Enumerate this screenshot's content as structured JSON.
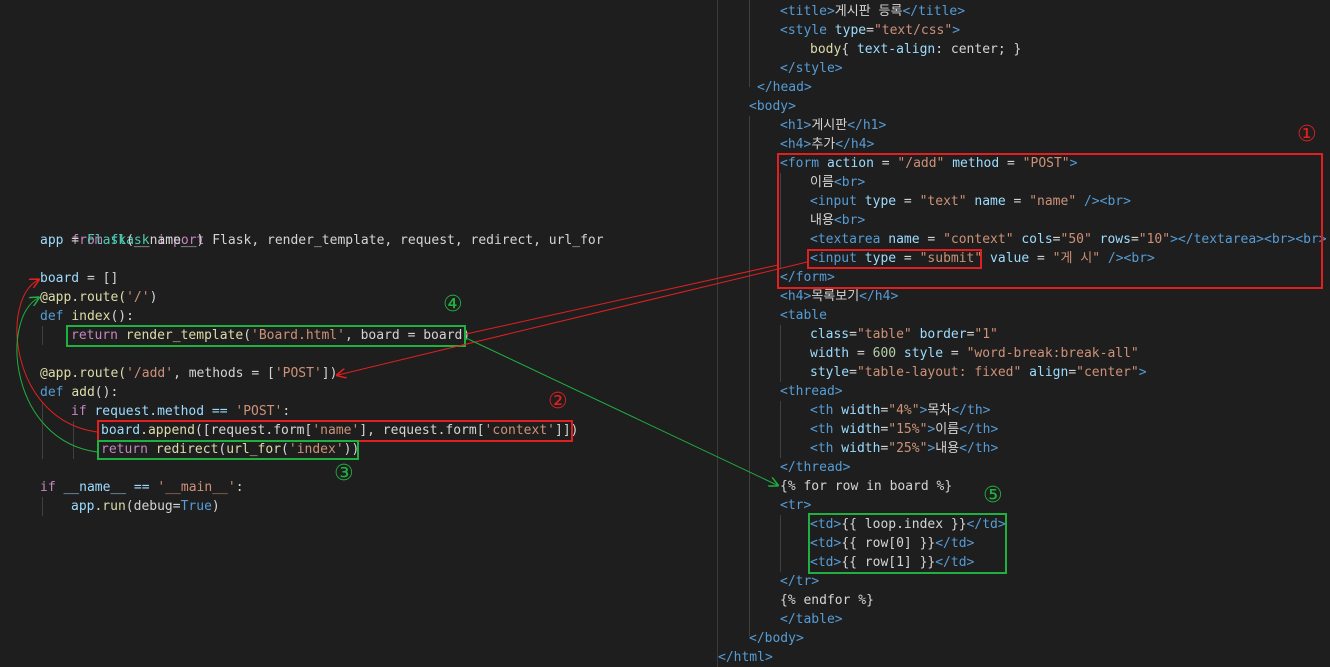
{
  "python": {
    "l1": {
      "from": "from",
      "module": "flask",
      "import": "import",
      "names": "Flask, render_template, request, redirect, url_for"
    },
    "l2": {
      "app": "app",
      "eq": " = ",
      "flask": "Flask",
      "arg": "(__name__)"
    },
    "l3": {
      "board": "board",
      "rest": " = []"
    },
    "l4": {
      "deco": "@app.route(",
      "path": "'/'",
      "close": ")"
    },
    "l5": {
      "def": "def",
      "name": "index",
      "rest": "():"
    },
    "l6": {
      "ret": "return",
      "fn": "render_template",
      "arg": "'Board.html'",
      "rest": ", board = board)"
    },
    "l7": {
      "deco": "@app.route(",
      "path": "'/add'",
      "mid": ", methods = [",
      "m": "'POST'",
      "close": "])"
    },
    "l8": {
      "def": "def",
      "name": "add",
      "rest": "():"
    },
    "l9": {
      "if": "if",
      "expr": " request.method == ",
      "val": "'POST'",
      "colon": ":"
    },
    "l10": {
      "obj": "board",
      "fn": ".append",
      "a": "([request.form[",
      "k1": "'name'",
      "b": "], request.form[",
      "k2": "'context'",
      "c": "]])"
    },
    "l11": {
      "ret": "return",
      "fn": "redirect",
      "a": "(",
      "fn2": "url_for",
      "b": "(",
      "arg": "'index'",
      "c": "))"
    },
    "l12": {
      "if": "if",
      "a": " __name__ == ",
      "main": "'__main__'",
      "colon": ":"
    },
    "l13": {
      "obj": "app",
      "fn": ".run",
      "a": "(debug=",
      "t": "True",
      "c": ")"
    }
  },
  "html_code": {
    "r1": {
      "open": "<title>",
      "text": "게시판 등록",
      "close": "</title>"
    },
    "r2": {
      "open": "<style",
      "attr": " type",
      "eq": "=",
      "val": "\"text/css\"",
      "gt": ">"
    },
    "r3": {
      "sel": "body",
      "a": "{ ",
      "prop": "text-align",
      "b": ": center; }"
    },
    "r4": {
      "tag": "</style>"
    },
    "r5": {
      "tag": "</head>"
    },
    "r6": {
      "tag": "<body>"
    },
    "r7": {
      "open": "<h1>",
      "text": "게시판",
      "close": "</h1>"
    },
    "r8": {
      "open": "<h4>",
      "text": "추가",
      "close": "</h4>"
    },
    "r9": {
      "open": "<form",
      "a1": " action",
      "eq1": " = ",
      "v1": "\"/add\"",
      "a2": " method",
      "eq2": " = ",
      "v2": "\"POST\"",
      "gt": ">"
    },
    "r10": {
      "text": "이름",
      "br": "<br>"
    },
    "r11": {
      "open": "<input",
      "a1": " type",
      "eq1": " = ",
      "v1": "\"text\"",
      "a2": " name",
      "eq2": " = ",
      "v2": "\"name\"",
      "end": " /><br>"
    },
    "r12": {
      "text": "내용",
      "br": "<br>"
    },
    "r13": {
      "open": "<textarea",
      "a1": " name",
      "eq1": " = ",
      "v1": "\"context\"",
      "a2": " cols",
      "eq2": "=",
      "v2": "\"50\"",
      "a3": " rows",
      "eq3": "=",
      "v3": "\"10\"",
      "end": "></textarea><br><br>"
    },
    "r14": {
      "open": "<input",
      "a1": " type",
      "eq1": " = ",
      "v1": "\"submit\"",
      "a2": " value",
      "eq2": " = ",
      "v2": "\"게 시\"",
      "end": " /><br>"
    },
    "r15": {
      "tag": "</form>"
    },
    "r16": {
      "open": "<h4>",
      "text": "목록보기",
      "close": "</h4>"
    },
    "r17": {
      "tag": "<table"
    },
    "r18": {
      "a1": "class",
      "eq1": "=",
      "v1": "\"table\"",
      "a2": " border",
      "eq2": "=",
      "v2": "\"1\""
    },
    "r19": {
      "a1": "width",
      "eq1": " = ",
      "n": "600",
      "a2": " style",
      "eq2": " = ",
      "v2": "\"word-break:break-all\""
    },
    "r20": {
      "a1": "style",
      "eq1": "=",
      "v1": "\"table-layout: fixed\"",
      "a2": " align",
      "eq2": "=",
      "v2": "\"center\"",
      "gt": ">"
    },
    "r21": {
      "tag": "<thread>"
    },
    "r22": {
      "open": "<th",
      "a": " width",
      "eq": "=",
      "v": "\"4%\"",
      "gt": ">",
      "text": "목차",
      "close": "</th>"
    },
    "r23": {
      "open": "<th",
      "a": " width",
      "eq": "=",
      "v": "\"15%\"",
      "gt": ">",
      "text": "이름",
      "close": "</th>"
    },
    "r24": {
      "open": "<th",
      "a": " width",
      "eq": "=",
      "v": "\"25%\"",
      "gt": ">",
      "text": "내용",
      "close": "</th>"
    },
    "r25": {
      "tag": "</thread>"
    },
    "r26": {
      "text": "{% for row in board %}"
    },
    "r27": {
      "tag": "<tr>"
    },
    "r28": {
      "open": "<td>",
      "text": "{{ loop.index }}",
      "close": "</td>"
    },
    "r29": {
      "open": "<td>",
      "text": "{{ row[0] }}",
      "close": "</td>"
    },
    "r30": {
      "open": "<td>",
      "text": "{{ row[1] }}",
      "close": "</td>"
    },
    "r31": {
      "tag": "</tr>"
    },
    "r32": {
      "text": "{% endfor %}"
    },
    "r33": {
      "tag": "</table>"
    },
    "r34": {
      "tag": "</body>"
    },
    "r35": {
      "tag": "</html>"
    }
  },
  "annotations": {
    "n1": "①",
    "n2": "②",
    "n3": "③",
    "n4": "④",
    "n5": "⑤"
  },
  "colors": {
    "red": "#e02020",
    "green": "#20b040",
    "background": "#1e1e1e"
  }
}
